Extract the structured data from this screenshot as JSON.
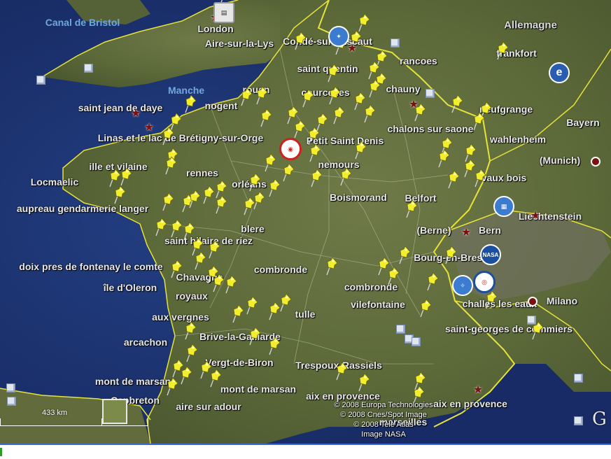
{
  "labels": {
    "water": [
      {
        "id": "canal-de-bristol",
        "text": "Canal de Bristol"
      },
      {
        "id": "manche",
        "text": "Manche"
      }
    ],
    "country": [
      {
        "id": "allemagne",
        "text": "Allemagne"
      }
    ],
    "places": [
      {
        "id": "london",
        "text": "London"
      },
      {
        "id": "aire-sur-la-lys",
        "text": "Aire-sur-la-Lys"
      },
      {
        "id": "conde-sur-escaut",
        "text": "Condé-sur-l'Escaut"
      },
      {
        "id": "saint-quentin",
        "text": "saint quentin"
      },
      {
        "id": "francoes",
        "text": "rancoes"
      },
      {
        "id": "frankfort",
        "text": "frankfort"
      },
      {
        "id": "rouen",
        "text": "rouen"
      },
      {
        "id": "courcelles",
        "text": "courcelles"
      },
      {
        "id": "chauny",
        "text": "chauny"
      },
      {
        "id": "saint-jean-de-daye",
        "text": "saint jean de daye"
      },
      {
        "id": "nogent",
        "text": "nogent"
      },
      {
        "id": "neufgrange",
        "text": "neufgrange"
      },
      {
        "id": "chalons-sur-saone",
        "text": "chalons sur saone"
      },
      {
        "id": "bayern",
        "text": "Bayern"
      },
      {
        "id": "linas",
        "text": "Linas et le lac de Brétigny-sur-Orge"
      },
      {
        "id": "petit-saint-denis",
        "text": "Petit Saint Denis"
      },
      {
        "id": "wahlenheim",
        "text": "wahlenheim"
      },
      {
        "id": "ille-et-vilaine",
        "text": "ille et vilaine"
      },
      {
        "id": "rennes",
        "text": "rennes"
      },
      {
        "id": "nemours",
        "text": "nemours"
      },
      {
        "id": "munich",
        "text": "(Munich)"
      },
      {
        "id": "locmaelic",
        "text": "Locmaelic"
      },
      {
        "id": "orleans",
        "text": "orléans"
      },
      {
        "id": "vaux-bois",
        "text": "vaux bois"
      },
      {
        "id": "boismorand",
        "text": "Boismorand"
      },
      {
        "id": "belfort",
        "text": "Belfort"
      },
      {
        "id": "aupreau",
        "text": "aupreau gendarmerie langer"
      },
      {
        "id": "liechtenstein",
        "text": "Liechtenstein"
      },
      {
        "id": "blere",
        "text": "blere"
      },
      {
        "id": "berne",
        "text": "(Berne)"
      },
      {
        "id": "bern",
        "text": "Bern"
      },
      {
        "id": "saint-hilaire-de-riez",
        "text": "saint hilaire de riez"
      },
      {
        "id": "doix",
        "text": "doix pres de fontenay le comte"
      },
      {
        "id": "combronde",
        "text": "combronde"
      },
      {
        "id": "bourg-en-bresse",
        "text": "Bourg-en-Bresse"
      },
      {
        "id": "chavagne",
        "text": "Chavagne"
      },
      {
        "id": "ile-d-oleron",
        "text": "île d'Oleron"
      },
      {
        "id": "royaux",
        "text": "royaux"
      },
      {
        "id": "combronde2",
        "text": "combronde"
      },
      {
        "id": "vilefontaine",
        "text": "vilefontaine"
      },
      {
        "id": "challes-les-eaux",
        "text": "challes les eaux"
      },
      {
        "id": "milano",
        "text": "Milano"
      },
      {
        "id": "aux-vergnes",
        "text": "aux vergnes"
      },
      {
        "id": "tulle",
        "text": "tulle"
      },
      {
        "id": "brive",
        "text": "Brive-la-Gaillarde"
      },
      {
        "id": "st-georges",
        "text": "saint-georges de commiers"
      },
      {
        "id": "arcachon",
        "text": "arcachon"
      },
      {
        "id": "vergt",
        "text": "Vergt-de-Biron"
      },
      {
        "id": "trespoux",
        "text": "Trespoux-Rassiels"
      },
      {
        "id": "mont-de-marsan",
        "text": "mont de marsan"
      },
      {
        "id": "mont-de-marsan2",
        "text": "mont de marsan"
      },
      {
        "id": "aix-en-provence",
        "text": "aix en provence"
      },
      {
        "id": "aix-en-provence2",
        "text": "aix en provence"
      },
      {
        "id": "capbreton",
        "text": "Capbreton"
      },
      {
        "id": "aire-sur-adour",
        "text": "aire sur adour"
      },
      {
        "id": "marseilles",
        "text": "marseilles"
      }
    ]
  },
  "credits": [
    "© 2008 Europa Technologies",
    "© 2008 Cnes/Spot Image",
    "© 2008 Tele Atlas",
    "Image NASA"
  ],
  "scale": {
    "label": "433 km"
  },
  "icons": {
    "pin": "yellow-pushpin-icon",
    "photo": "photo-placemark-icon",
    "star": "star-placemark-icon",
    "dot": "capital-dot-icon",
    "google": "google-logo"
  },
  "colors": {
    "ocean": "#1c2f6b",
    "land": "#5d6a3a",
    "border": "#e6e23a",
    "pin": "#f2ee2c"
  }
}
